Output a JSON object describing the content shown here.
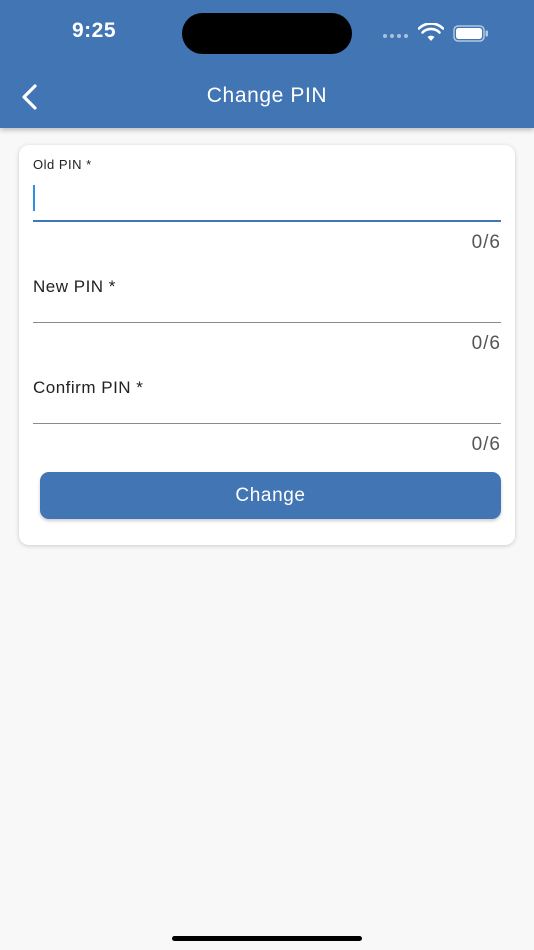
{
  "status_bar": {
    "time": "9:25",
    "icons": [
      "signal-icon",
      "wifi-icon",
      "battery-icon"
    ]
  },
  "app_bar": {
    "title": "Change PIN",
    "back_icon": "chevron-left-icon",
    "color": "#4175b4"
  },
  "form": {
    "old_pin": {
      "label": "Old PIN *",
      "value": "",
      "counter": "0/6",
      "focused": true
    },
    "new_pin": {
      "label": "New PIN *",
      "value": "",
      "counter": "0/6"
    },
    "confirm_pin": {
      "label": "Confirm PIN *",
      "value": "",
      "counter": "0/6"
    },
    "submit_label": "Change"
  }
}
